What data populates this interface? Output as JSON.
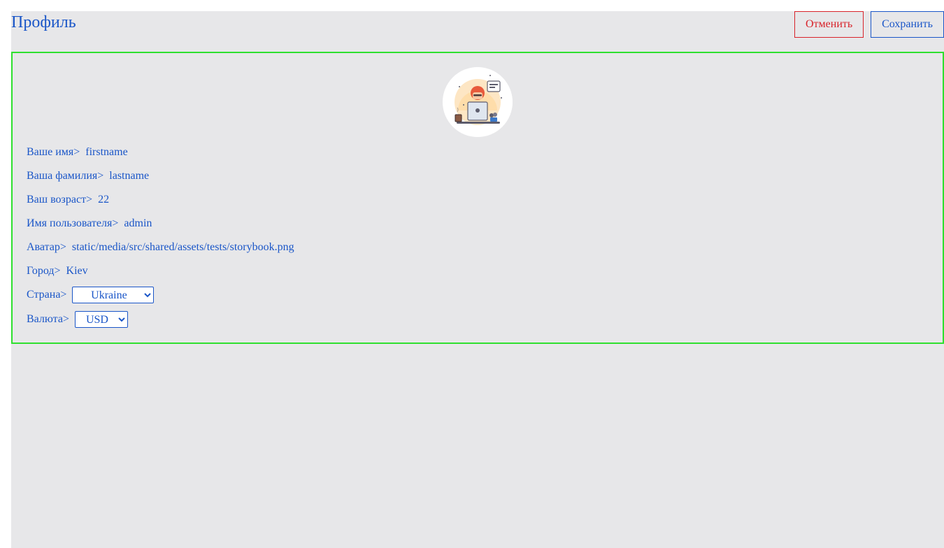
{
  "header": {
    "title": "Профиль",
    "cancel_label": "Отменить",
    "save_label": "Сохранить"
  },
  "profile": {
    "avatar_icon": "developer-avatar-icon",
    "fields": {
      "firstname": {
        "label": "Ваше имя>",
        "value": "firstname"
      },
      "lastname": {
        "label": "Ваша фамилия>",
        "value": "lastname"
      },
      "age": {
        "label": "Ваш возраст>",
        "value": "22"
      },
      "username": {
        "label": "Имя пользователя>",
        "value": "admin"
      },
      "avatar": {
        "label": "Аватар>",
        "value": "static/media/src/shared/assets/tests/storybook.png"
      },
      "city": {
        "label": "Город>",
        "value": "Kiev"
      },
      "country": {
        "label": "Страна>",
        "value": "Ukraine"
      },
      "currency": {
        "label": "Валюта>",
        "value": "USD"
      }
    }
  },
  "colors": {
    "accent": "#1a56c8",
    "danger": "#d8232a",
    "card_border": "#2fe02f",
    "background": "#e7e7e9"
  }
}
